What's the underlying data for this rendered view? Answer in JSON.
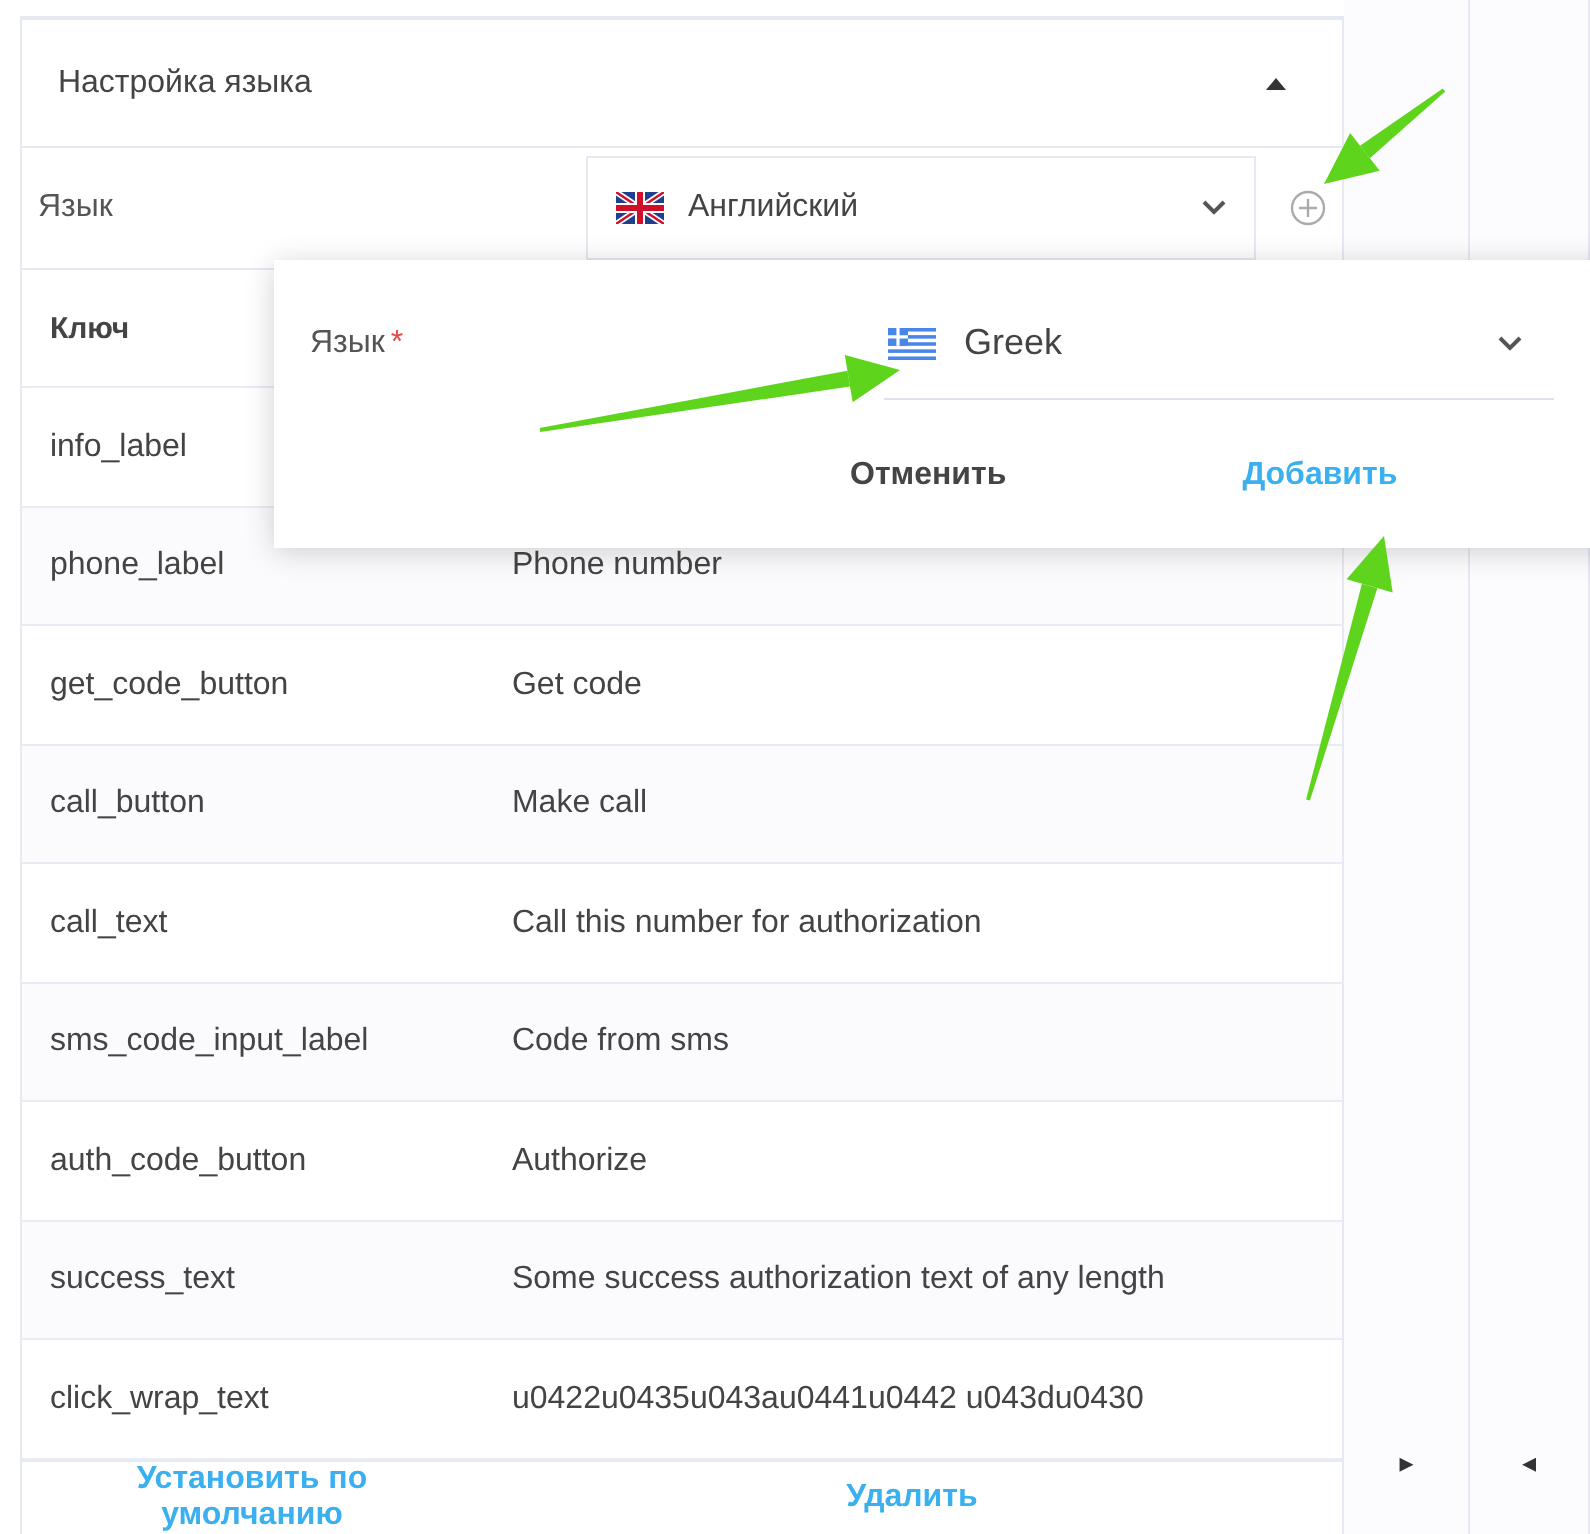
{
  "section": {
    "title": "Настройка языка",
    "expanded": true
  },
  "language_row": {
    "label": "Язык",
    "value": "Английский"
  },
  "table": {
    "columns": [
      "Ключ"
    ],
    "rows": [
      {
        "key": "info_label"
      },
      {
        "key": "phone_label",
        "value": "Phone number"
      },
      {
        "key": "get_code_button",
        "value": "Get code"
      },
      {
        "key": "call_button",
        "value": "Make call"
      },
      {
        "key": "call_text",
        "value": "Call this number for authorization"
      },
      {
        "key": "sms_code_input_label",
        "value": "Code from sms"
      },
      {
        "key": "auth_code_button",
        "value": "Authorize"
      },
      {
        "key": "success_text",
        "value": "Some success authorization text of any length"
      },
      {
        "key": "click_wrap_text",
        "value": "u0422u0435u043au0441u0442 u043du0430"
      }
    ]
  },
  "footer": {
    "buttons": [
      "Установить по умолчанию",
      "Удалить"
    ]
  },
  "side_columns": [
    {
      "arrow": "▸"
    },
    {
      "arrow": "◂"
    }
  ],
  "popup": {
    "label": "Язык",
    "required_mark": "*",
    "value": "Greek",
    "buttons": [
      {
        "label": "Отменить",
        "kind": "secondary"
      },
      {
        "label": "Добавить",
        "kind": "primary"
      }
    ]
  }
}
